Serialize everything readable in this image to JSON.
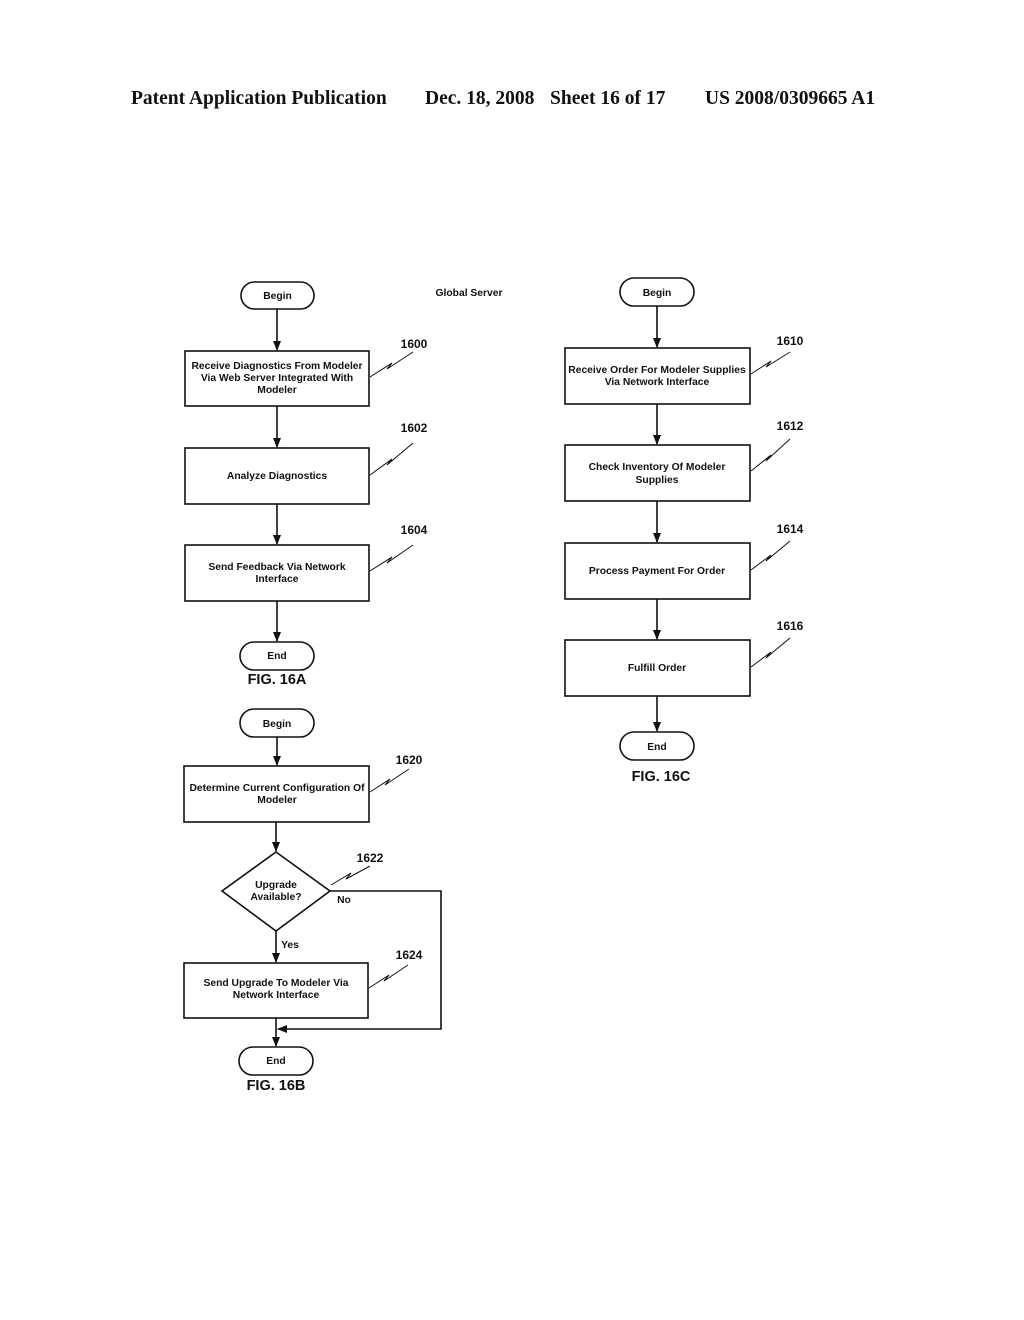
{
  "header": {
    "publication": "Patent Application Publication",
    "date": "Dec. 18, 2008",
    "sheet": "Sheet 16 of 17",
    "number": "US 2008/0309665 A1"
  },
  "section_label": "Global Server",
  "fig16a": {
    "caption": "FIG. 16A",
    "begin": "Begin",
    "end": "End",
    "steps": [
      {
        "ref": "1600",
        "lines": [
          "Receive Diagnostics From Modeler",
          "Via Web Server Integrated With",
          "Modeler"
        ]
      },
      {
        "ref": "1602",
        "lines": [
          "Analyze Diagnostics"
        ]
      },
      {
        "ref": "1604",
        "lines": [
          "Send Feedback Via Network",
          "Interface"
        ]
      }
    ]
  },
  "fig16b": {
    "caption": "FIG. 16B",
    "begin": "Begin",
    "end": "End",
    "step_1620": {
      "ref": "1620",
      "lines": [
        "Determine Current Configuration Of",
        "Modeler"
      ]
    },
    "decision_1622": {
      "ref": "1622",
      "lines": [
        "Upgrade",
        "Available?"
      ],
      "yes_label": "Yes",
      "no_label": "No"
    },
    "step_1624": {
      "ref": "1624",
      "lines": [
        "Send Upgrade To Modeler Via",
        "Network Interface"
      ]
    }
  },
  "fig16c": {
    "caption": "FIG. 16C",
    "begin": "Begin",
    "end": "End",
    "steps": [
      {
        "ref": "1610",
        "lines": [
          "Receive Order For Modeler Supplies",
          "Via Network Interface"
        ]
      },
      {
        "ref": "1612",
        "lines": [
          "Check Inventory Of Modeler",
          "Supplies"
        ]
      },
      {
        "ref": "1614",
        "lines": [
          "Process Payment For Order"
        ]
      },
      {
        "ref": "1616",
        "lines": [
          "Fulfill Order"
        ]
      }
    ]
  }
}
